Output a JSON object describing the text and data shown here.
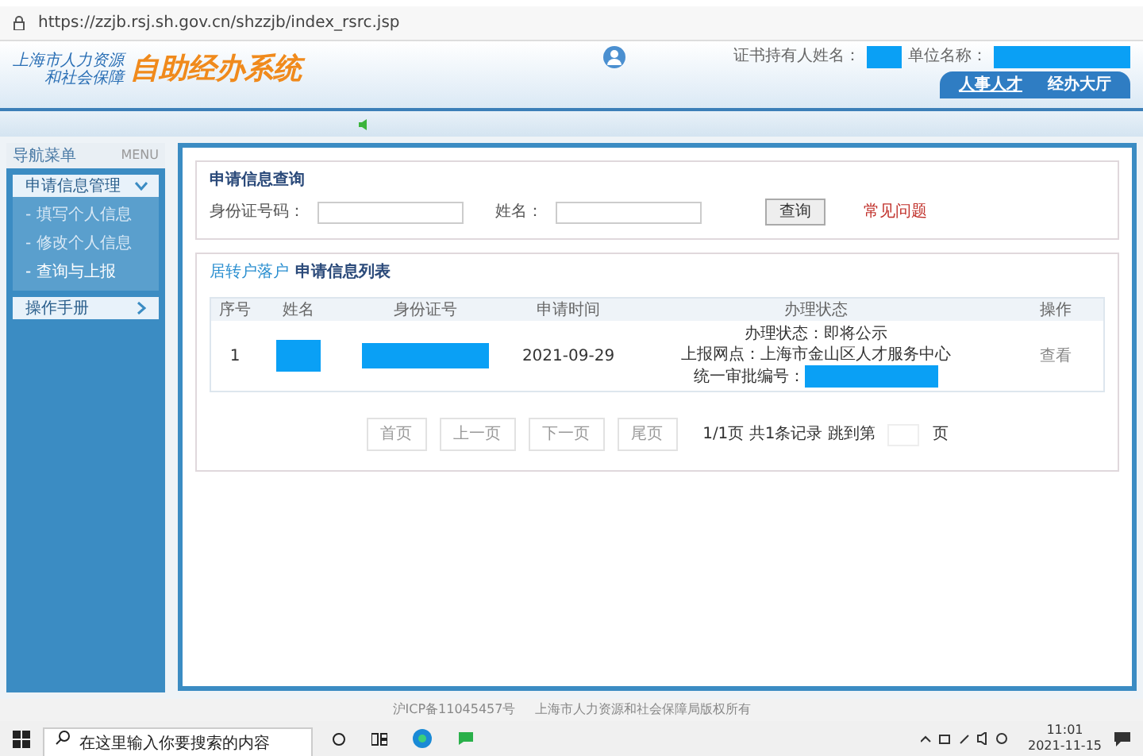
{
  "browser": {
    "url": "https://zzjb.rsj.sh.gov.cn/shzzjb/index_rsrc.jsp"
  },
  "header": {
    "org_line_1": "上海市人力资源",
    "org_line_2": "和社会保障",
    "system_name": "自助经办系统",
    "holder_label": "证书持有人姓名：",
    "unit_label": "单位名称：",
    "tabs": [
      {
        "label": "人事人才",
        "selected": true
      },
      {
        "label": "经办大厅",
        "selected": false
      }
    ]
  },
  "sidebar": {
    "title": "导航菜单",
    "title_en": "MENU",
    "items": [
      {
        "label": "申请信息管理",
        "expanded": true,
        "children": [
          {
            "label": "- 填写个人信息",
            "selected": false
          },
          {
            "label": "- 修改个人信息",
            "selected": false
          },
          {
            "label": "- 查询与上报",
            "selected": true
          }
        ]
      },
      {
        "label": "操作手册",
        "expanded": false
      }
    ]
  },
  "query": {
    "legend": "申请信息查询",
    "id_label": "身份证号码：",
    "name_label": "姓名：",
    "button": "查询",
    "faq_link": "常见问题"
  },
  "list": {
    "legend_prefix": "居转户落户",
    "legend": "申请信息列表",
    "columns": [
      "序号",
      "姓名",
      "身份证号",
      "申请时间",
      "办理状态",
      "操作"
    ],
    "rows": [
      {
        "index": "1",
        "date": "2021-09-29",
        "status_lines": [
          "办理状态：即将公示",
          "上报网点：上海市金山区人才服务中心"
        ],
        "approval_label": "统一审批编号：",
        "action": "查看"
      }
    ],
    "pager": {
      "buttons": [
        "首页",
        "上一页",
        "下一页",
        "尾页"
      ],
      "summary": "1/1页 共1条记录 跳到第",
      "page_suffix": "页"
    }
  },
  "footer": {
    "icp": "沪ICP备11045457号",
    "copyright": "上海市人力资源和社会保障局版权所有"
  },
  "taskbar": {
    "search_placeholder": "在这里输入你要搜索的内容",
    "time": "11:01",
    "date": "2021-11-15"
  }
}
